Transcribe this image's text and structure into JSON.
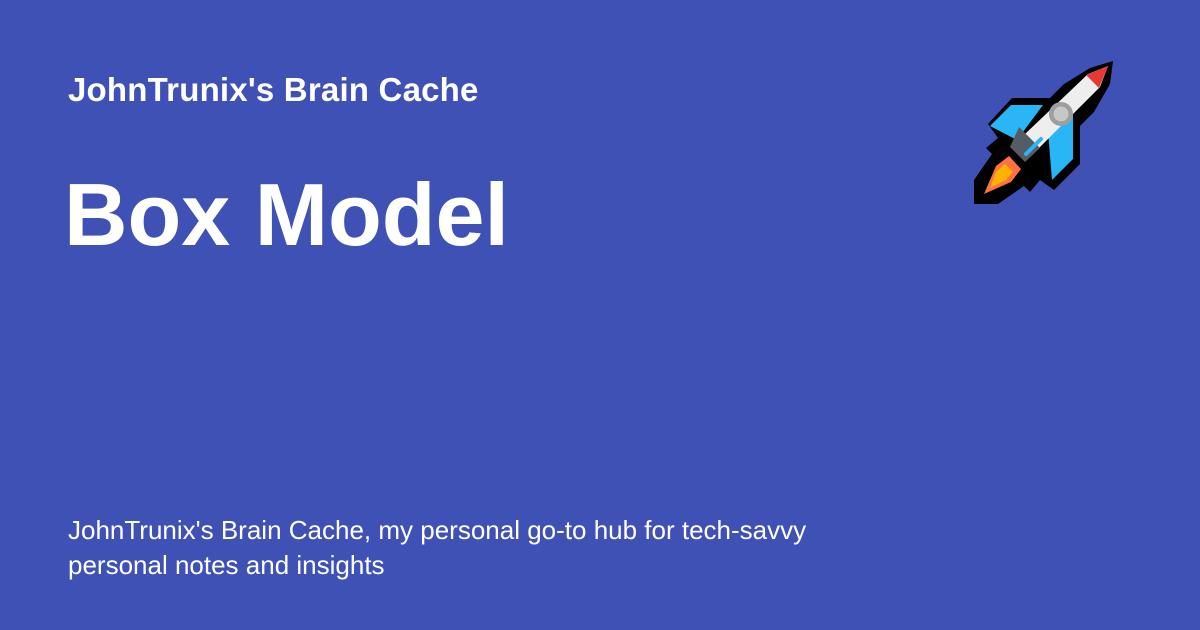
{
  "site": {
    "name": "JohnTrunix's Brain Cache"
  },
  "post": {
    "title": "Box Model",
    "description": "JohnTrunix's Brain Cache, my personal go-to hub for tech-savvy personal notes and insights"
  },
  "icon": {
    "name": "rocket-icon"
  },
  "colors": {
    "background": "#3f51b5",
    "text": "#ffffff"
  }
}
